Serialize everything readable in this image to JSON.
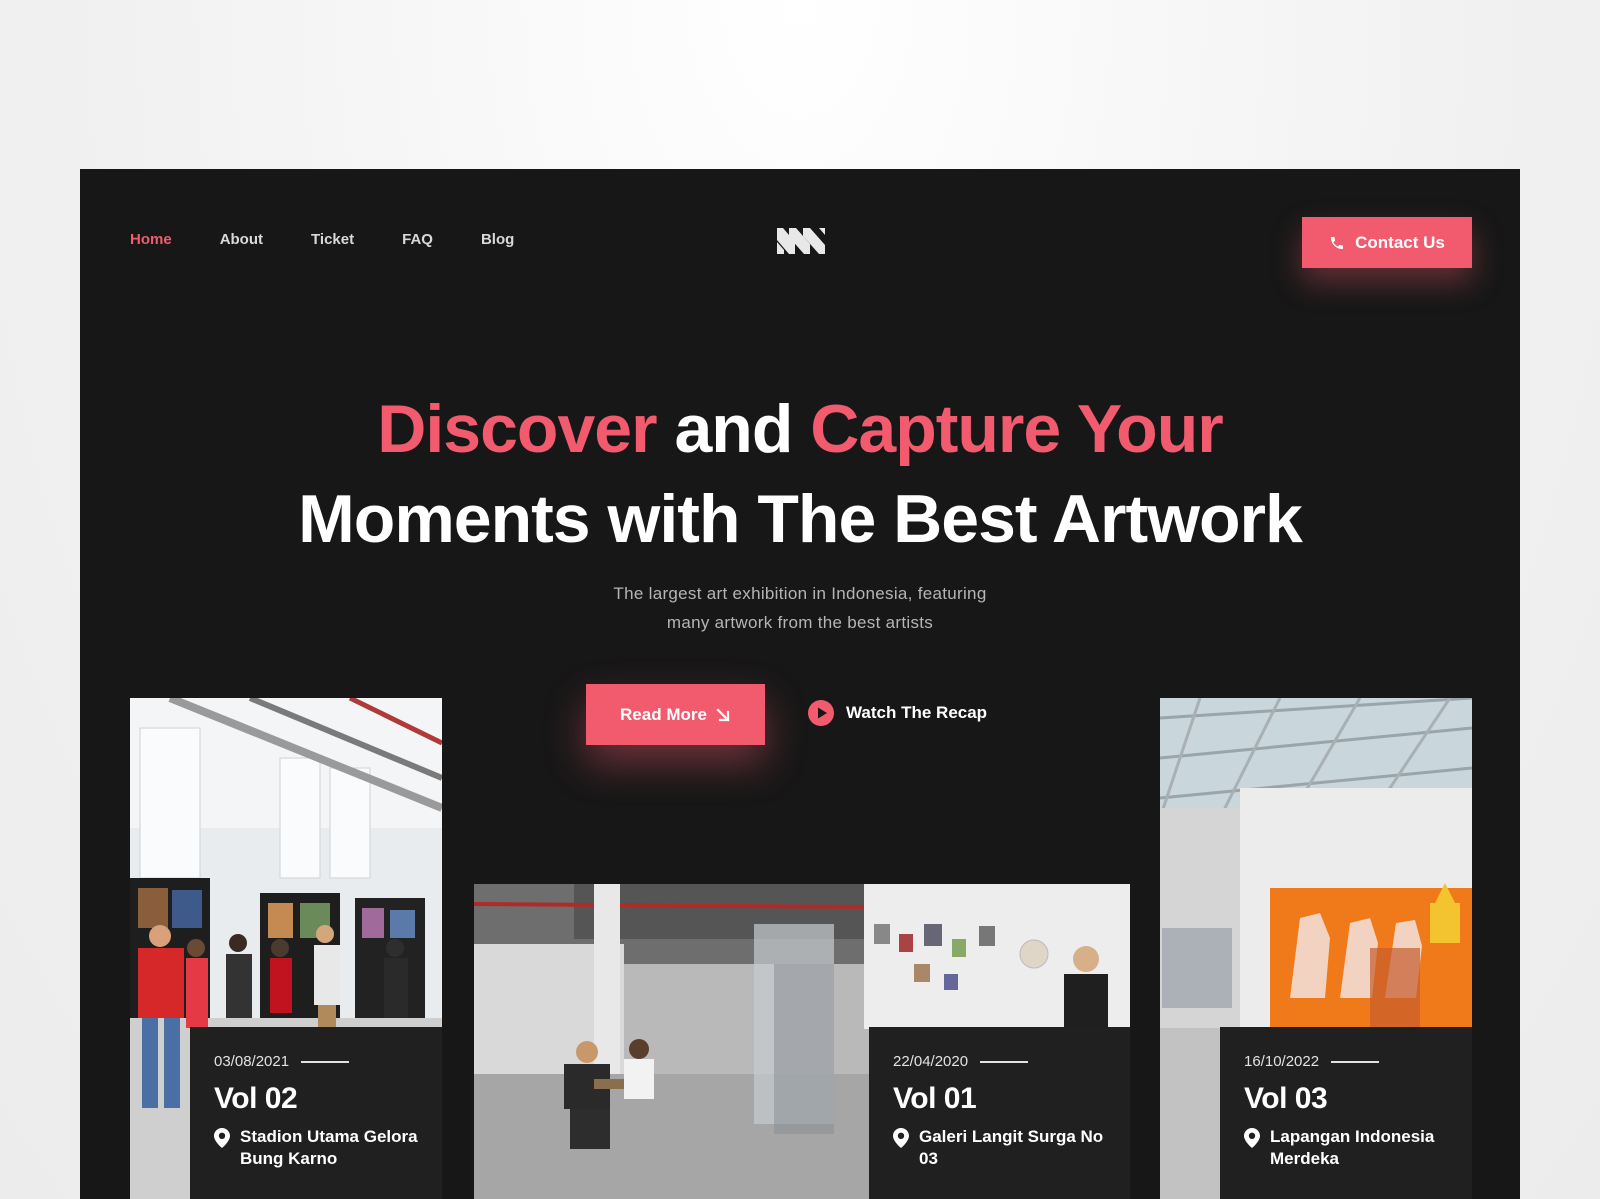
{
  "nav": {
    "items": [
      {
        "label": "Home",
        "active": true
      },
      {
        "label": "About"
      },
      {
        "label": "Ticket"
      },
      {
        "label": "FAQ"
      },
      {
        "label": "Blog"
      }
    ],
    "contact_label": "Contact Us"
  },
  "hero": {
    "title_word1": "Discover",
    "title_word2": "and",
    "title_word3": "Capture Your",
    "title_line2": "Moments with The Best Artwork",
    "subtitle_line1": "The largest art exhibition in Indonesia, featuring",
    "subtitle_line2": "many artwork from the best artists",
    "read_more_label": "Read More",
    "watch_label": "Watch The Recap"
  },
  "events": [
    {
      "date": "03/08/2021",
      "volume": "Vol 02",
      "location_line1": "Stadion Utama Gelora",
      "location_line2": "Bung Karno"
    },
    {
      "date": "22/04/2020",
      "volume": "Vol 01",
      "location_line1": "Galeri Langit Surga No",
      "location_line2": "03"
    },
    {
      "date": "16/10/2022",
      "volume": "Vol 03",
      "location_line1": "Lapangan Indonesia",
      "location_line2": "Merdeka"
    }
  ],
  "colors": {
    "accent": "#f25b6e",
    "background": "#171717",
    "card": "#202020"
  },
  "icons": {
    "logo": "brand-logo",
    "contact": "phone-icon",
    "read_more": "arrow-down-right-icon",
    "watch": "play-icon",
    "location": "location-pin-icon"
  }
}
